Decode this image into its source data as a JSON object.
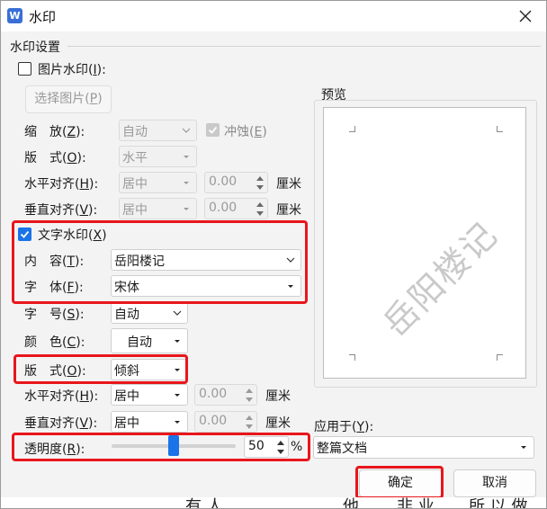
{
  "window": {
    "title": "水印",
    "app_icon_letter": "W"
  },
  "section": {
    "label": "水印设置"
  },
  "picture_watermark": {
    "checkbox_label": "图片水印",
    "checkbox_key": "I",
    "checked": false,
    "select_button": "选择图片",
    "select_button_key": "P",
    "scale_label": "缩　放",
    "scale_key": "Z",
    "scale_value": "自动",
    "washout_label": "冲蚀",
    "washout_key": "E",
    "layout_label": "版　式",
    "layout_key": "O",
    "layout_value": "水平",
    "h_align_label": "水平对齐",
    "h_align_key": "H",
    "h_align_value": "居中",
    "h_offset": "0.00",
    "v_align_label": "垂直对齐",
    "v_align_key": "V",
    "v_align_value": "居中",
    "v_offset": "0.00",
    "unit": "厘米"
  },
  "text_watermark": {
    "checkbox_label": "文字水印",
    "checkbox_key": "X",
    "checked": true,
    "content_label": "内　容",
    "content_key": "T",
    "content_value": "岳阳楼记",
    "font_label": "字　体",
    "font_key": "F",
    "font_value": "宋体",
    "size_label": "字　号",
    "size_key": "S",
    "size_value": "自动",
    "color_label": "颜　色",
    "color_key": "C",
    "color_value": "自动",
    "layout_label": "版　式",
    "layout_key": "O",
    "layout_value": "倾斜",
    "h_align_label": "水平对齐",
    "h_align_key": "H",
    "h_align_value": "居中",
    "h_offset": "0.00",
    "v_align_label": "垂直对齐",
    "v_align_key": "V",
    "v_align_value": "居中",
    "v_offset": "0.00",
    "unit": "厘米",
    "transparency_label": "透明度",
    "transparency_key": "R",
    "transparency_value": "50",
    "transparency_fraction": 0.5,
    "percent": "%"
  },
  "preview": {
    "label": "预览",
    "watermark_text": "岳阳楼记"
  },
  "apply_to": {
    "label": "应用于",
    "key": "Y",
    "value": "整篇文档"
  },
  "buttons": {
    "ok": "确定",
    "cancel": "取消"
  },
  "background_text": [
    "有 人",
    "他",
    "非 业",
    "所 以 做"
  ],
  "colors": {
    "accent": "#1a73e8",
    "highlight": "#e8161c"
  },
  "icons": {
    "close": "close-icon",
    "dropdown": "chevron-down-icon",
    "spin_up": "triangle-up-icon",
    "spin_down": "triangle-down-icon",
    "check": "check-icon"
  }
}
